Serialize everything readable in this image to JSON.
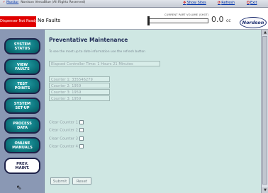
{
  "topbar": {
    "monitor_label": "Monitor",
    "copyright": "Nordson VersaBlue (All Rights Reserved)",
    "show_sites_label": "Show Sites",
    "refresh_label": "Refresh",
    "exit_label": "Exit"
  },
  "status": {
    "alarm_text": "Dispenser Not Ready",
    "alarm_color": "#e00000",
    "faults_text": "No Faults",
    "fill_label": "CURRENT PART VOLUME (SHOT)",
    "fill_value": "0.0",
    "fill_unit": "cc",
    "brand": "Nordson"
  },
  "sidebar": {
    "items": [
      {
        "label": "SYSTEM\nSTATUS"
      },
      {
        "label": "VIEW\nFAULTS"
      },
      {
        "label": "TEST\nPOINTS"
      },
      {
        "label": "SYSTEM\nSET-UP"
      },
      {
        "label": "PROCESS\nDATA"
      },
      {
        "label": "ONLINE\nMANUALS"
      },
      {
        "label": "PREV.\nMAINT."
      }
    ]
  },
  "main": {
    "title": "Preventative Maintenance",
    "hint": "To see the most up to date information use the refresh button",
    "elapsed": "Elapsed Controller Time: 1 Hours 21 Minutes",
    "counters": [
      "Counter 1: 335546279",
      "Counter 2: 1959",
      "Counter 3: 1959",
      "Counter 3: 1959"
    ],
    "clear_labels": [
      "Clear Counter 1",
      "Clear Counter 2",
      "Clear Counter 3",
      "Clear Counter 4"
    ],
    "submit_label": "Submit",
    "reset_label": "Reset"
  },
  "colors": {
    "nav_button": "#0f7a82",
    "content_bg": "#cfe7e3",
    "frame_bg": "#8a98b4"
  }
}
